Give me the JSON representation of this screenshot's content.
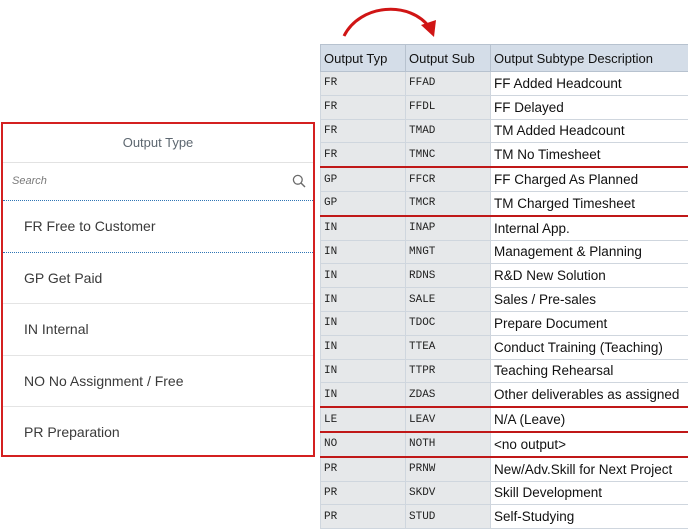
{
  "left_panel": {
    "title": "Output Type",
    "search_placeholder": "Search",
    "items": [
      {
        "label": "FR Free to Customer"
      },
      {
        "label": "GP Get Paid"
      },
      {
        "label": "IN Internal"
      },
      {
        "label": "NO No Assignment / Free"
      },
      {
        "label": "PR Preparation"
      }
    ]
  },
  "table": {
    "headers": [
      "Output Typ",
      "Output Sub",
      "Output Subtype Description"
    ],
    "rows": [
      {
        "type": "FR",
        "sub": "FFAD",
        "desc": "FF Added Headcount"
      },
      {
        "type": "FR",
        "sub": "FFDL",
        "desc": "FF Delayed"
      },
      {
        "type": "FR",
        "sub": "TMAD",
        "desc": "TM Added Headcount"
      },
      {
        "type": "FR",
        "sub": "TMNC",
        "desc": "TM No Timesheet"
      },
      {
        "type": "GP",
        "sub": "FFCR",
        "desc": "FF Charged As Planned"
      },
      {
        "type": "GP",
        "sub": "TMCR",
        "desc": "TM Charged Timesheet"
      },
      {
        "type": "IN",
        "sub": "INAP",
        "desc": "Internal App."
      },
      {
        "type": "IN",
        "sub": "MNGT",
        "desc": "Management & Planning"
      },
      {
        "type": "IN",
        "sub": "RDNS",
        "desc": "R&D New Solution"
      },
      {
        "type": "IN",
        "sub": "SALE",
        "desc": "Sales / Pre-sales"
      },
      {
        "type": "IN",
        "sub": "TDOC",
        "desc": "Prepare Document"
      },
      {
        "type": "IN",
        "sub": "TTEA",
        "desc": "Conduct Training (Teaching)"
      },
      {
        "type": "IN",
        "sub": "TTPR",
        "desc": "Teaching Rehearsal"
      },
      {
        "type": "IN",
        "sub": "ZDAS",
        "desc": "Other deliverables as assigned"
      },
      {
        "type": "LE",
        "sub": "LEAV",
        "desc": "N/A (Leave)"
      },
      {
        "type": "NO",
        "sub": "NOTH",
        "desc": "<no output>"
      },
      {
        "type": "PR",
        "sub": "PRNW",
        "desc": "New/Adv.Skill for Next Project"
      },
      {
        "type": "PR",
        "sub": "SKDV",
        "desc": "Skill Development"
      },
      {
        "type": "PR",
        "sub": "STUD",
        "desc": "Self-Studying"
      }
    ]
  },
  "colors": {
    "accent": "#d42020",
    "header_bg": "#d4dde8",
    "code_bg": "#e6e8ea",
    "divider": "#2f75b5"
  },
  "icons": {
    "search": "search-icon",
    "arrow": "curved-arrow-icon"
  }
}
